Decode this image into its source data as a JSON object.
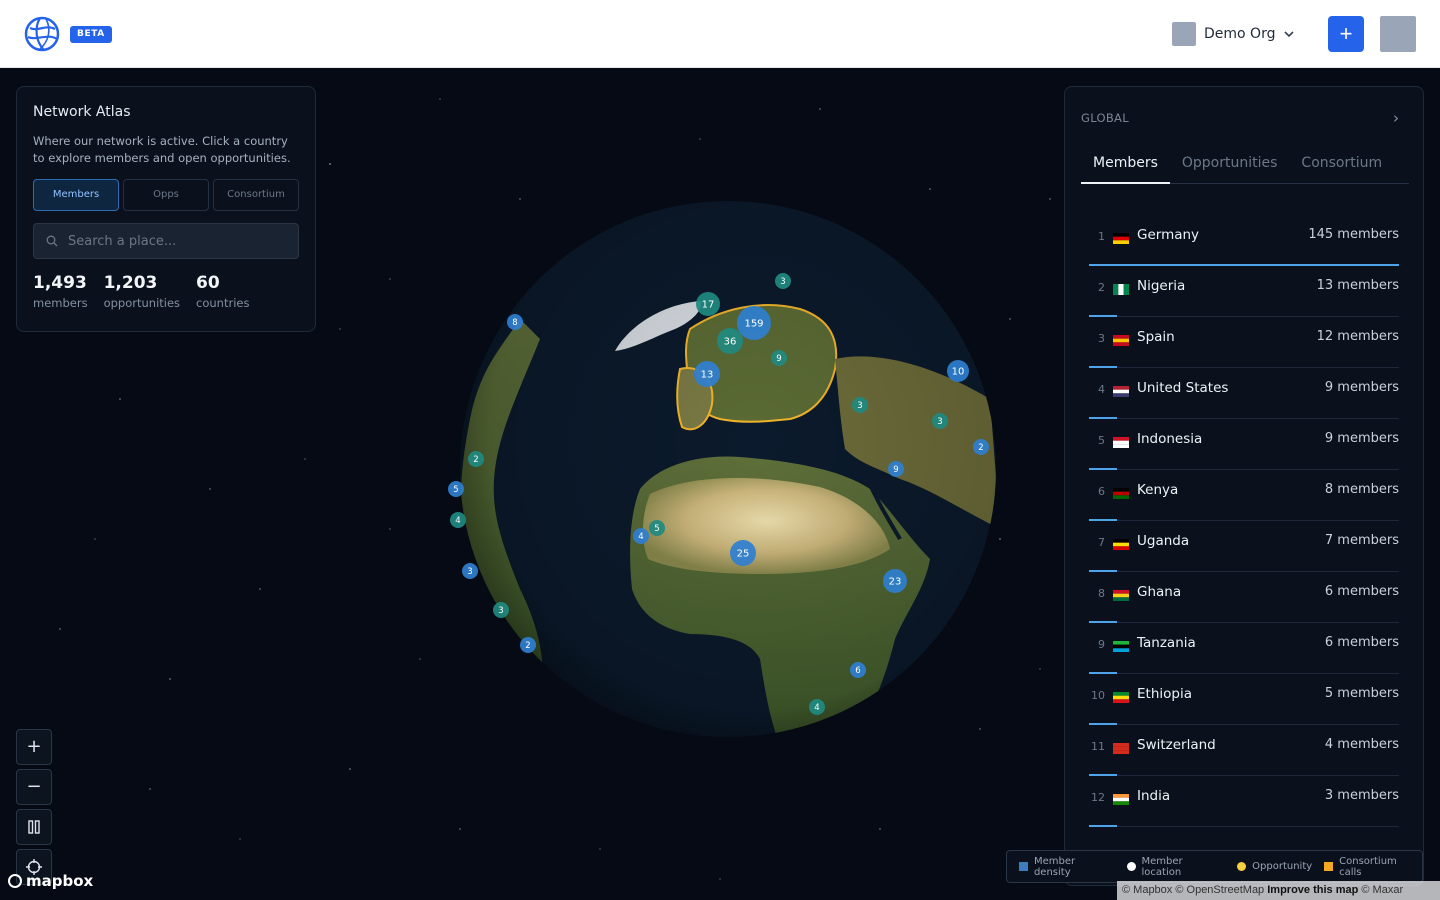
{
  "header": {
    "beta_label": "BETA",
    "org_name": "Demo Org",
    "add_label": "+"
  },
  "left_panel": {
    "title": "Network Atlas",
    "description": "Where our network is active. Click a country to explore members and open opportunities.",
    "tabs": [
      {
        "label": "Members",
        "active": true
      },
      {
        "label": "Opps",
        "active": false
      },
      {
        "label": "Consortium",
        "active": false
      }
    ],
    "search_placeholder": "Search a place...",
    "stats": [
      {
        "value": "1,493",
        "label": "members"
      },
      {
        "value": "1,203",
        "label": "opportunities"
      },
      {
        "value": "60",
        "label": "countries"
      }
    ]
  },
  "right_panel": {
    "scope": "GLOBAL",
    "tabs": [
      {
        "label": "Members",
        "active": true
      },
      {
        "label": "Opportunities",
        "active": false
      },
      {
        "label": "Consortium",
        "active": false
      }
    ],
    "rows": [
      {
        "rank": "1",
        "country": "Germany",
        "count": "145 members",
        "share": 1.0,
        "flag": [
          "#000000",
          "#dd0000",
          "#ffce00"
        ]
      },
      {
        "rank": "2",
        "country": "Nigeria",
        "count": "13 members",
        "share": 0.09,
        "flag": [
          "#008751",
          "#ffffff",
          "#008751"
        ],
        "vertical": true
      },
      {
        "rank": "3",
        "country": "Spain",
        "count": "12 members",
        "share": 0.083,
        "flag": [
          "#c60b1e",
          "#ffc400",
          "#c60b1e"
        ]
      },
      {
        "rank": "4",
        "country": "United States",
        "count": "9 members",
        "share": 0.062,
        "flag": [
          "#b22234",
          "#ffffff",
          "#3c3b6e"
        ]
      },
      {
        "rank": "5",
        "country": "Indonesia",
        "count": "9 members",
        "share": 0.062,
        "flag": [
          "#ce1126",
          "#ffffff",
          "#ffffff"
        ]
      },
      {
        "rank": "6",
        "country": "Kenya",
        "count": "8 members",
        "share": 0.055,
        "flag": [
          "#000000",
          "#bb0000",
          "#006600"
        ]
      },
      {
        "rank": "7",
        "country": "Uganda",
        "count": "7 members",
        "share": 0.048,
        "flag": [
          "#000000",
          "#fcdc04",
          "#d90000"
        ]
      },
      {
        "rank": "8",
        "country": "Ghana",
        "count": "6 members",
        "share": 0.041,
        "flag": [
          "#ce1126",
          "#fcd116",
          "#006b3f"
        ]
      },
      {
        "rank": "9",
        "country": "Tanzania",
        "count": "6 members",
        "share": 0.041,
        "flag": [
          "#1eb53a",
          "#000000",
          "#00a3dd"
        ]
      },
      {
        "rank": "10",
        "country": "Ethiopia",
        "count": "5 members",
        "share": 0.034,
        "flag": [
          "#078930",
          "#fcdd09",
          "#da121a"
        ]
      },
      {
        "rank": "11",
        "country": "Switzerland",
        "count": "4 members",
        "share": 0.028,
        "flag": [
          "#d52b1e",
          "#d52b1e",
          "#d52b1e"
        ]
      },
      {
        "rank": "12",
        "country": "India",
        "count": "3 members",
        "share": 0.021,
        "flag": [
          "#ff9933",
          "#ffffff",
          "#138808"
        ]
      }
    ]
  },
  "map": {
    "clusters": [
      "159",
      "36",
      "17",
      "13",
      "9",
      "3",
      "25",
      "23",
      "10",
      "9",
      "5",
      "4",
      "3",
      "3",
      "6",
      "4",
      "8",
      "2",
      "5",
      "4",
      "3",
      "3",
      "2",
      "2"
    ],
    "controls": {
      "zoom_in": "+",
      "zoom_out": "−",
      "pause": "⏸",
      "locate": "◎"
    },
    "mapbox_label": "mapbox",
    "attribution": {
      "mapbox": "© Mapbox",
      "osm": "© OpenStreetMap",
      "improve": "Improve this map",
      "maxar": "© Maxar"
    }
  },
  "legend": {
    "items": [
      {
        "label": "Member density",
        "color": "#3b7bbf"
      },
      {
        "label": "Member location",
        "color": "#ffffff"
      },
      {
        "label": "Opportunity",
        "color": "#f4d03f"
      },
      {
        "label": "Consortium calls",
        "color": "#f5a623"
      }
    ]
  },
  "colors": {
    "accent": "#2563eb",
    "panel_bg": "#0b121e",
    "cluster_teal": "#1f8a80",
    "cluster_blue": "#2f7fd0",
    "europe_outline": "#f2b42a"
  }
}
